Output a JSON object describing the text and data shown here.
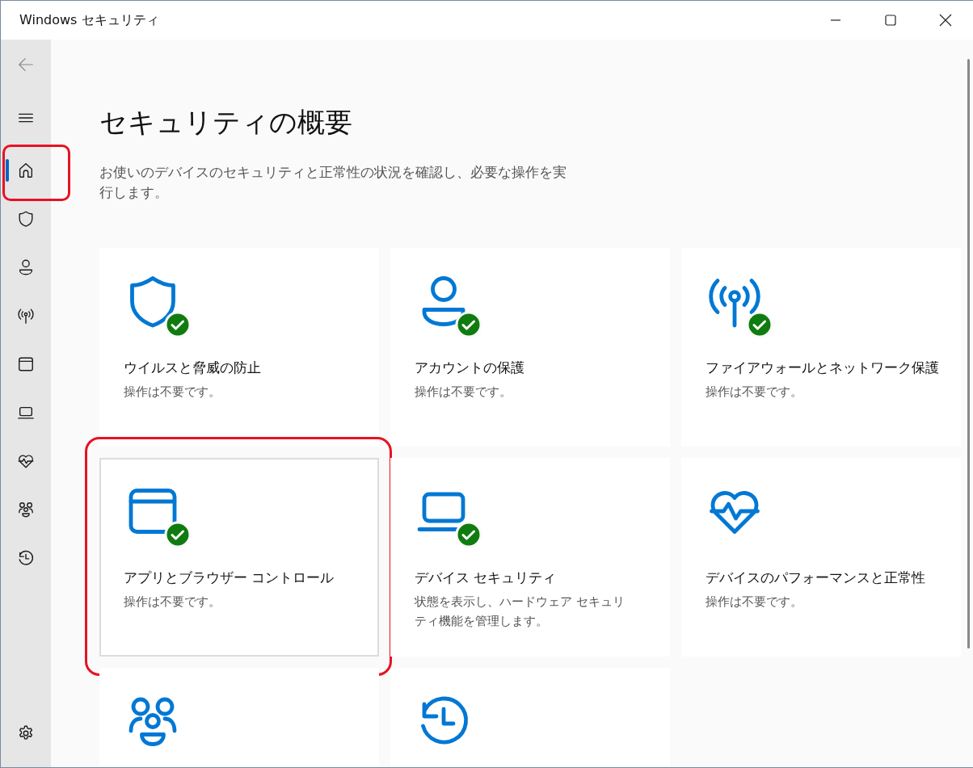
{
  "window": {
    "title": "Windows セキュリティ"
  },
  "sidebar": {
    "items": [
      {
        "kind": "back",
        "selected": false,
        "highlighted": false
      },
      {
        "kind": "menu",
        "selected": false,
        "highlighted": false
      },
      {
        "kind": "home",
        "selected": true,
        "highlighted": true
      },
      {
        "kind": "shield",
        "selected": false,
        "highlighted": false
      },
      {
        "kind": "person",
        "selected": false,
        "highlighted": false
      },
      {
        "kind": "antenna",
        "selected": false,
        "highlighted": false
      },
      {
        "kind": "window",
        "selected": false,
        "highlighted": false
      },
      {
        "kind": "laptop",
        "selected": false,
        "highlighted": false
      },
      {
        "kind": "heart",
        "selected": false,
        "highlighted": false
      },
      {
        "kind": "family",
        "selected": false,
        "highlighted": false
      },
      {
        "kind": "history",
        "selected": false,
        "highlighted": false
      }
    ],
    "footer": {
      "kind": "settings"
    }
  },
  "page": {
    "title": "セキュリティの概要",
    "description": "お使いのデバイスのセキュリティと正常性の状況を確認し、必要な操作を実行します。"
  },
  "cards": [
    {
      "kind": "shield",
      "title": "ウイルスと脅威の防止",
      "status": "操作は不要です。",
      "ok": true,
      "focused": false,
      "highlighted": false
    },
    {
      "kind": "person",
      "title": "アカウントの保護",
      "status": "操作は不要です。",
      "ok": true,
      "focused": false,
      "highlighted": false
    },
    {
      "kind": "antenna",
      "title": "ファイアウォールとネットワーク保護",
      "status": "操作は不要です。",
      "ok": true,
      "focused": false,
      "highlighted": false
    },
    {
      "kind": "window",
      "title": "アプリとブラウザー コントロール",
      "status": "操作は不要です。",
      "ok": true,
      "focused": true,
      "highlighted": true
    },
    {
      "kind": "laptop",
      "title": "デバイス セキュリティ",
      "status": "状態を表示し、ハードウェア セキュリティ機能を管理します。",
      "ok": true,
      "focused": false,
      "highlighted": false
    },
    {
      "kind": "heart",
      "title": "デバイスのパフォーマンスと正常性",
      "status": "操作は不要です。",
      "ok": false,
      "focused": false,
      "highlighted": false
    },
    {
      "kind": "family",
      "ok": false,
      "focused": false,
      "highlighted": false
    },
    {
      "kind": "history",
      "ok": false,
      "focused": false,
      "highlighted": false
    }
  ]
}
